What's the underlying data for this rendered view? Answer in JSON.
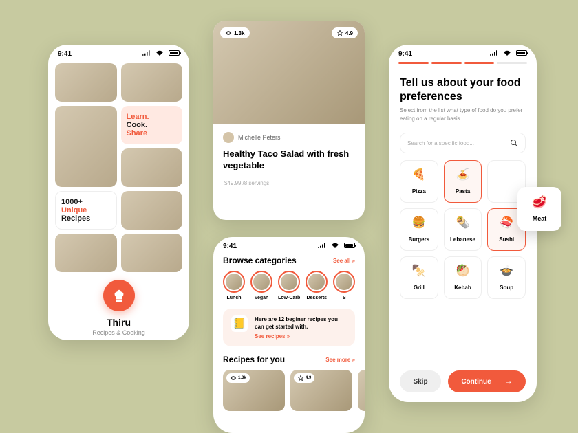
{
  "status": {
    "time": "9:41"
  },
  "screen1": {
    "app_name": "Thiru",
    "app_tagline": "Recipes & Cooking",
    "learn": "Learn.",
    "cook": "Cook.",
    "share": "Share",
    "recipes_count": "1000+",
    "unique": "Unique",
    "recipes_word": "Recipes"
  },
  "recipe_card": {
    "views": "1.3k",
    "rating": "4.9",
    "author": "Michelle Peters",
    "title": "Healthy Taco Salad with fresh vegetable",
    "price": "$49.99",
    "servings": "/8 servings"
  },
  "screen2": {
    "browse_title": "Browse categories",
    "see_all": "See all »",
    "categories": [
      "Lunch",
      "Vegan",
      "Low-Carb",
      "Desserts",
      "S"
    ],
    "promo_text": "Here are 12 beginer recipes you can get started with.",
    "promo_link": "See recipes »",
    "recipes_title": "Recipes for you",
    "see_more": "See more »",
    "mini_views": "1.3k",
    "mini_rating": "4.9"
  },
  "screen3": {
    "title": "Tell us about your food preferences",
    "subtitle": "Select from the list what type of food do you prefer eating on a regular basis.",
    "search_placeholder": "Search for a specific food...",
    "items": [
      {
        "icon": "🍕",
        "label": "Pizza",
        "selected": false
      },
      {
        "icon": "🍝",
        "label": "Pasta",
        "selected": true
      },
      {
        "icon": "",
        "label": "",
        "selected": false
      },
      {
        "icon": "🍔",
        "label": "Burgers",
        "selected": false
      },
      {
        "icon": "🌯",
        "label": "Lebanese",
        "selected": false
      },
      {
        "icon": "🍣",
        "label": "Sushi",
        "selected": true
      },
      {
        "icon": "🍢",
        "label": "Grill",
        "selected": false
      },
      {
        "icon": "🥙",
        "label": "Kebab",
        "selected": false
      },
      {
        "icon": "🍲",
        "label": "Soup",
        "selected": false
      }
    ],
    "skip": "Skip",
    "continue": "Continue",
    "floating": {
      "icon": "🥩",
      "label": "Meat"
    }
  },
  "colors": {
    "accent": "#f15a3c",
    "canvas": "#c7caa0"
  }
}
